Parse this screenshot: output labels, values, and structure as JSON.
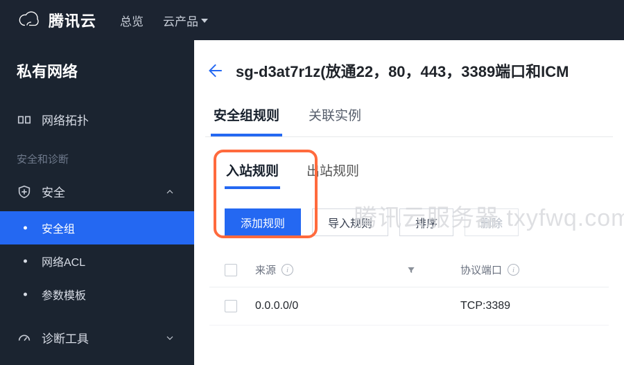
{
  "topbar": {
    "brand": "腾讯云",
    "overview": "总览",
    "products": "云产品"
  },
  "sidebar": {
    "title": "私有网络",
    "topology": "网络拓扑",
    "section_security_label": "安全和诊断",
    "security": "安全",
    "sub_security_group": "安全组",
    "sub_acl": "网络ACL",
    "sub_param_template": "参数模板",
    "diag_tools": "诊断工具"
  },
  "main": {
    "page_title": "sg-d3at7r1z(放通22，80，443，3389端口和ICM",
    "tabs": {
      "rules": "安全组规则",
      "instances": "关联实例"
    },
    "sub_tabs": {
      "inbound": "入站规则",
      "outbound": "出站规则"
    },
    "toolbar": {
      "add_rule": "添加规则",
      "import_rule": "导入规则",
      "sort": "排序",
      "delete": "删除"
    },
    "table": {
      "head": {
        "source": "来源",
        "proto_port": "协议端口"
      },
      "rows": [
        {
          "source": "0.0.0.0/0",
          "proto": "TCP:3389"
        }
      ]
    }
  },
  "watermark": "腾讯云服务器 txyfwq.com"
}
